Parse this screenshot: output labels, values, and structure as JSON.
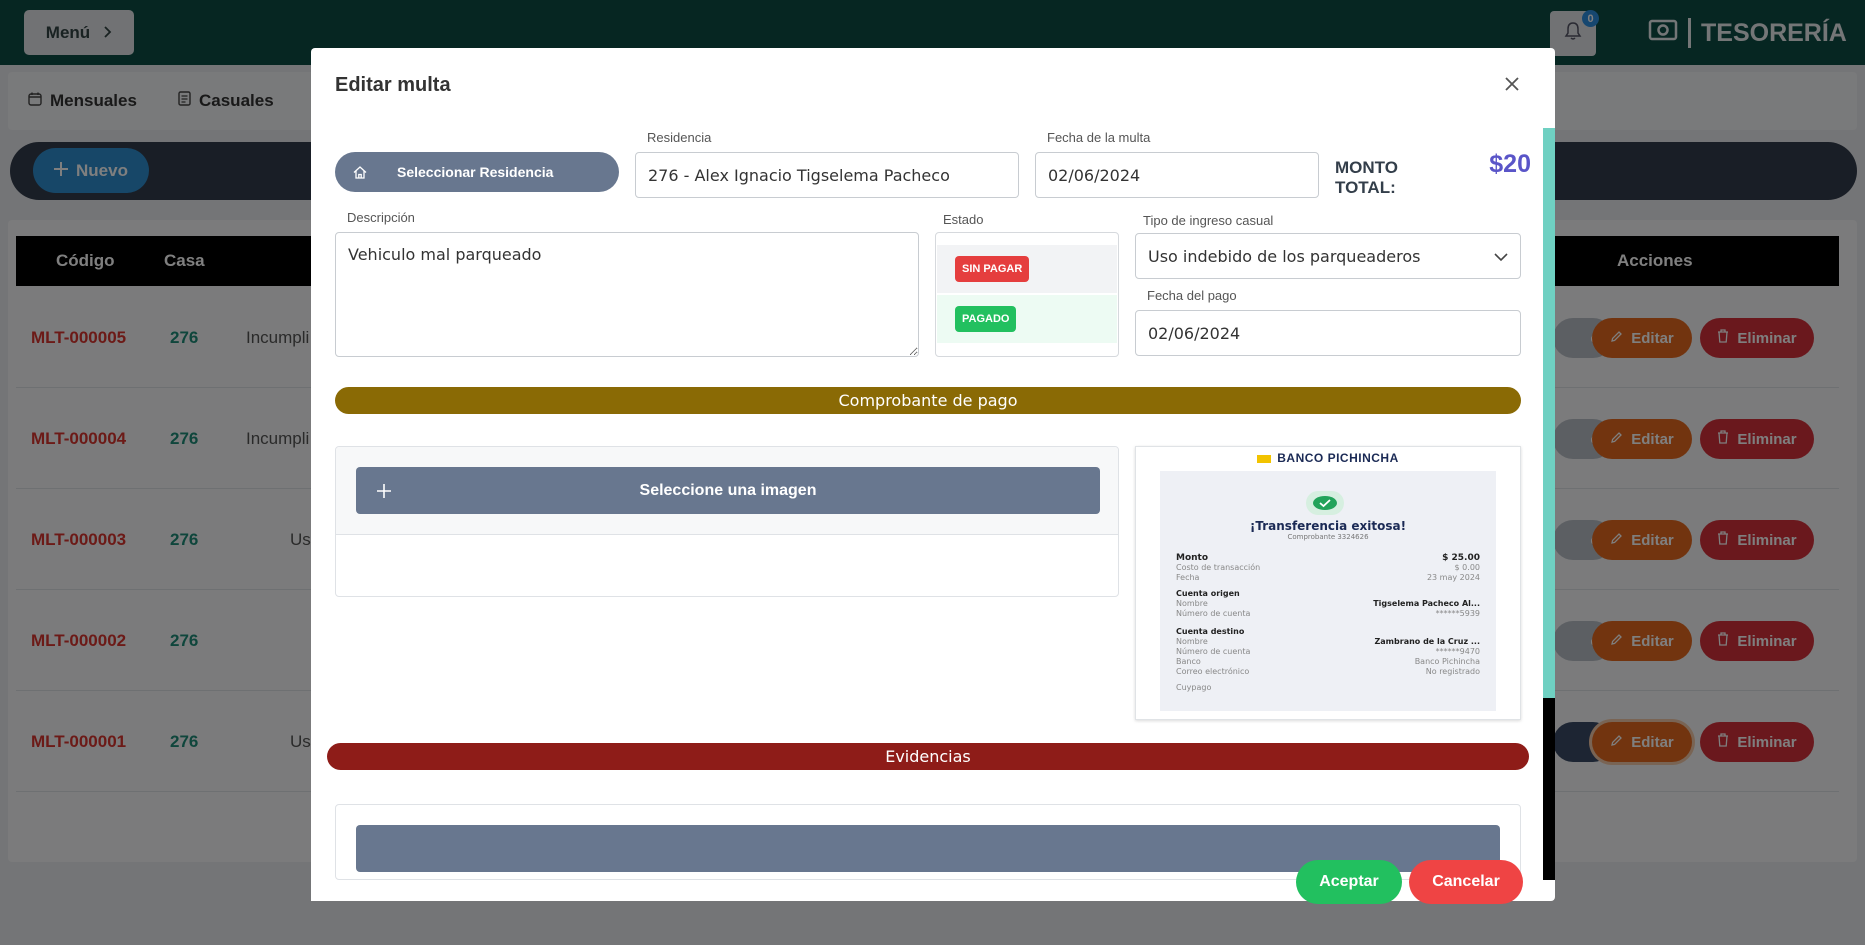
{
  "header": {
    "menu_label": "Menú",
    "notification_count": "0",
    "brand_title": "TESORERÍA"
  },
  "tabs": [
    {
      "label": "Mensuales"
    },
    {
      "label": "Casuales"
    }
  ],
  "toolbar": {
    "new_label": "Nuevo"
  },
  "table": {
    "columns": [
      "Código",
      "Casa",
      "Acciones"
    ],
    "rows": [
      {
        "code": "MLT-000005",
        "casa": "276",
        "desc": "Incumpli"
      },
      {
        "code": "MLT-000004",
        "casa": "276",
        "desc": "Incumpli"
      },
      {
        "code": "MLT-000003",
        "casa": "276",
        "desc": "Us"
      },
      {
        "code": "MLT-000002",
        "casa": "276",
        "desc": ""
      },
      {
        "code": "MLT-000001",
        "casa": "276",
        "desc": "Us"
      }
    ],
    "view_label": "o",
    "edit_label": "Editar",
    "delete_label": "Eliminar"
  },
  "modal": {
    "title": "Editar multa",
    "select_residence_label": "Seleccionar Residencia",
    "residence": {
      "label": "Residencia",
      "value": "276 - Alex Ignacio Tigselema Pacheco"
    },
    "fine_date": {
      "label": "Fecha de la multa",
      "value": "02/06/2024"
    },
    "total": {
      "label": "MONTO TOTAL:",
      "value": "$20"
    },
    "description": {
      "label": "Descripción",
      "value": "Vehiculo mal parqueado"
    },
    "status": {
      "label": "Estado",
      "options": [
        "SIN PAGAR",
        "PAGADO"
      ],
      "selected": "PAGADO"
    },
    "income_type": {
      "label": "Tipo de ingreso casual",
      "value": "Uso indebido de los parqueaderos"
    },
    "payment_date": {
      "label": "Fecha del pago",
      "value": "02/06/2024"
    },
    "receipt_section": "Comprobante de pago",
    "select_image_label": "Seleccione una imagen",
    "evidence_section": "Evidencias",
    "accept_label": "Aceptar",
    "cancel_label": "Cancelar"
  },
  "receipt": {
    "bank": "BANCO PICHINCHA",
    "title": "¡Transferencia exitosa!",
    "subtitle": "Comprobante 3324626",
    "amount_label": "Monto",
    "amount_value": "$ 25.00",
    "fee_label": "Costo de transacción",
    "fee_value": "$ 0.00",
    "date_label": "Fecha",
    "date_value": "23 may 2024",
    "origin_header": "Cuenta origen",
    "origin_name_label": "Nombre",
    "origin_name_value": "Tigselema Pacheco Al...",
    "origin_account_label": "Número de cuenta",
    "origin_account_value": "******5939",
    "dest_header": "Cuenta destino",
    "dest_name_label": "Nombre",
    "dest_name_value": "Zambrano de la Cruz ...",
    "dest_account_label": "Número de cuenta",
    "dest_account_value": "******9470",
    "dest_bank_label": "Banco",
    "dest_bank_value": "Banco Pichincha",
    "dest_email_label": "Correo electrónico",
    "dest_email_value": "No registrado",
    "footer": "Cuypago"
  },
  "colors": {
    "topbar": "#0d4d45",
    "accent_gold": "#8a6a05",
    "accent_darkred": "#8e1c18",
    "accept": "#22c05f",
    "cancel": "#ef4444",
    "unpaid_badge": "#e53e3e",
    "paid_badge": "#22c05f",
    "total_value": "#5a55c8"
  }
}
